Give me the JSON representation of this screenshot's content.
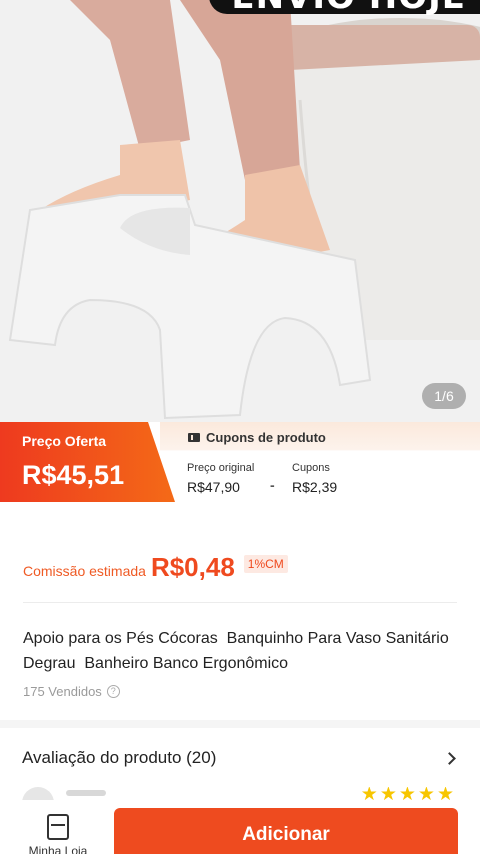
{
  "hero": {
    "banner_text": "ENVIO HOJE",
    "page_indicator": "1/6"
  },
  "price": {
    "offer_label": "Preço Oferta",
    "offer_value": "R$45,51",
    "coupon_title": "Cupons de produto",
    "original_label": "Preço original",
    "original_value": "R$47,90",
    "separator": "-",
    "coupons_label": "Cupons",
    "coupons_value": "R$2,39"
  },
  "commission": {
    "label": "Comissão estimada",
    "value": "R$0,48",
    "badge": "1%CM"
  },
  "product": {
    "title": "Apoio para os Pés Cócoras  Banquinho Para Vaso Sanitário Degrau  Banheiro Banco Ergonômico",
    "sold": "175 Vendidos",
    "help_glyph": "?"
  },
  "rating": {
    "title": "Avaliação do produto (20)",
    "stars": [
      "★",
      "★",
      "★",
      "★",
      "★"
    ]
  },
  "bottom": {
    "store_label": "Minha Loja",
    "add_label": "Adicionar"
  },
  "colors": {
    "accent": "#ee4b1f",
    "star": "#f7c600"
  }
}
